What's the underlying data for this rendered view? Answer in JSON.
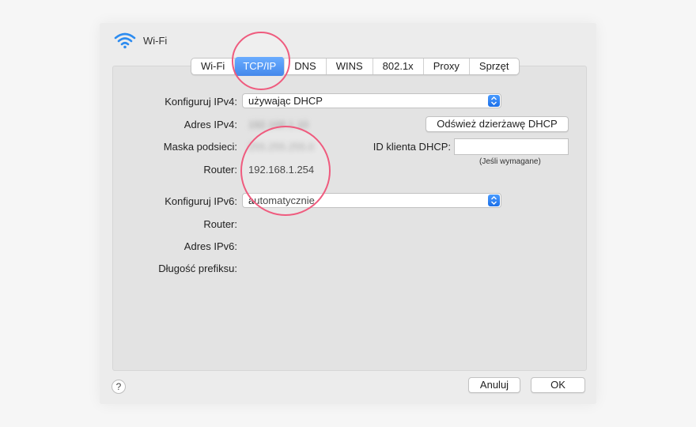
{
  "window": {
    "title": "Wi-Fi"
  },
  "tabs": [
    {
      "label": "Wi-Fi",
      "active": false
    },
    {
      "label": "TCP/IP",
      "active": true
    },
    {
      "label": "DNS",
      "active": false
    },
    {
      "label": "WINS",
      "active": false
    },
    {
      "label": "802.1x",
      "active": false
    },
    {
      "label": "Proxy",
      "active": false
    },
    {
      "label": "Sprzęt",
      "active": false
    }
  ],
  "ipv4": {
    "configure_label": "Konfiguruj IPv4:",
    "configure_value": "używając DHCP",
    "address_label": "Adres IPv4:",
    "address_value": "192.168.1.10",
    "subnet_label": "Maska podsieci:",
    "subnet_value": "255.255.255.0",
    "router_label": "Router:",
    "router_value": "192.168.1.254"
  },
  "dhcp": {
    "renew_button": "Odśwież dzierżawę DHCP",
    "client_id_label": "ID klienta DHCP:",
    "client_id_value": "",
    "client_id_hint": "(Jeśli wymagane)"
  },
  "ipv6": {
    "configure_label": "Konfiguruj IPv6:",
    "configure_value": "automatycznie",
    "router_label": "Router:",
    "address_label": "Adres IPv6:",
    "prefix_label": "Długość prefiksu:"
  },
  "footer": {
    "help": "?",
    "cancel_button": "Anuluj",
    "ok_button": "OK"
  },
  "colors": {
    "accent": "#1b6fe8",
    "highlight_circle": "#ef5b7e",
    "wifi_icon": "#2d8cf0"
  },
  "icons": {
    "wifi": "wifi-icon",
    "popup_arrows": "updown-arrows-icon",
    "help": "help-icon"
  }
}
